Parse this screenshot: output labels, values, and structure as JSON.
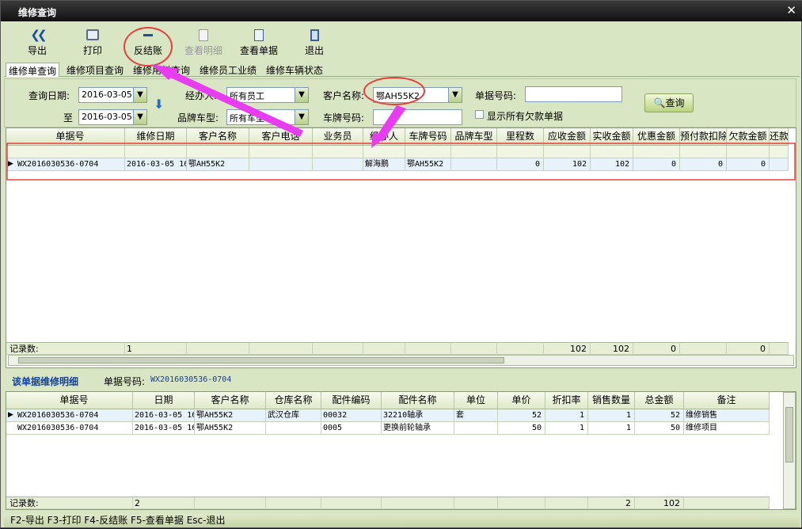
{
  "window": {
    "title": "维修查询",
    "close": "✕"
  },
  "toolbar": {
    "export": "导出",
    "print": "打印",
    "reverse": "反结账",
    "view_detail": "查看明细",
    "view_doc": "查看单据",
    "exit": "退出"
  },
  "tabs": [
    "维修单查询",
    "维修项目查询",
    "维修用料查询",
    "维修员工业绩",
    "维修车辆状态"
  ],
  "filters": {
    "date_label": "查询日期:",
    "date_from": "2016-03-05",
    "to_label": "至",
    "date_to": "2016-03-05",
    "handler_label": "经办人:",
    "handler": "所有员工",
    "brand_label": "品牌车型:",
    "brand": "所有车型",
    "customer_label": "客户名称:",
    "customer": "鄂AH55K2",
    "doc_label": "单据号码:",
    "doc_value": "",
    "plate_label": "车牌号码:",
    "plate_value": "",
    "show_debt": "显示所有欠款单据",
    "query": "查询"
  },
  "main_grid": {
    "columns": [
      "单据号",
      "维修日期",
      "客户名称",
      "客户电话",
      "业务员",
      "经办人",
      "车牌号码",
      "品牌车型",
      "里程数",
      "应收金额",
      "实收金额",
      "优惠金额",
      "预付款扣除",
      "欠款金额",
      "还款"
    ],
    "rows": [
      [
        "WX2016030536-0704",
        "2016-03-05 16",
        "鄂AH55K2",
        "",
        "",
        "解海鹏",
        "鄂AH55K2",
        "",
        "0",
        "102",
        "102",
        "0",
        "0",
        "0",
        ""
      ]
    ],
    "footer": [
      "记录数:",
      "1",
      "",
      "",
      "",
      "",
      "",
      "",
      "",
      "102",
      "102",
      "0",
      "",
      "0",
      ""
    ]
  },
  "detail": {
    "title": "该单据维修明细",
    "doc_label": "单据号码:",
    "doc_value": "WX2016030536-0704",
    "columns": [
      "单据号",
      "日期",
      "客户名称",
      "仓库名称",
      "配件编码",
      "配件名称",
      "单位",
      "单价",
      "折扣率",
      "销售数量",
      "总金额",
      "备注"
    ],
    "rows": [
      [
        "WX2016030536-0704",
        "2016-03-05 16",
        "鄂AH55K2",
        "武汉仓库",
        "00032",
        "32210轴承",
        "套",
        "52",
        "1",
        "1",
        "52",
        "维修销售"
      ],
      [
        "WX2016030536-0704",
        "2016-03-05 16",
        "鄂AH55K2",
        "",
        "0005",
        "更换前轮轴承",
        "",
        "50",
        "1",
        "1",
        "50",
        "维修项目"
      ]
    ],
    "footer": [
      "记录数:",
      "2",
      "",
      "",
      "",
      "",
      "",
      "",
      "",
      "2",
      "102",
      ""
    ]
  },
  "status": "F2-导出  F3-打印  F4-反结账  F5-查看单据  Esc-退出",
  "colors": {
    "annotation": "#e5403a",
    "arrow": "#e83cf0"
  }
}
